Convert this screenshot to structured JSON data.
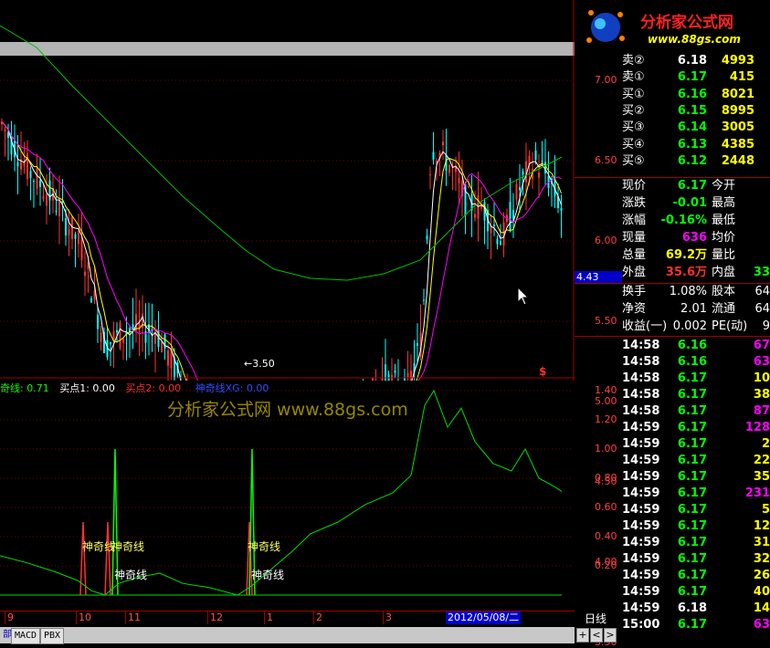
{
  "logo": {
    "title": "分析家公式网",
    "url": "www.88gs.com"
  },
  "main_chart": {
    "y_ticks": [
      "7.00",
      "6.50",
      "6.00",
      "5.50",
      "5.00",
      "4.50",
      "4.00",
      "3.50"
    ],
    "low_annotation": "←3.50",
    "current_price_tag": "4.43",
    "marker": "$"
  },
  "indicator": {
    "legend": [
      {
        "label": "奇线: 0.71",
        "color": "#00ff00"
      },
      {
        "label": "买点1: 0.00",
        "color": "#ffffff"
      },
      {
        "label": "买点2: 0.00",
        "color": "#ff3030"
      },
      {
        "label": "神奇线XG: 0.00",
        "color": "#3050ff"
      }
    ],
    "watermark": "分析家公式网 www.88gs.com",
    "y_ticks": [
      "1.40",
      "1.20",
      "1.00",
      "0.80",
      "0.60",
      "0.40",
      "0.20"
    ],
    "signal_labels": [
      "神奇线",
      "神奇线",
      "神奇线",
      "神奇线",
      "神奇线"
    ]
  },
  "x_axis": {
    "labels": [
      "9",
      "10",
      "11",
      "12",
      "1",
      "2",
      "3"
    ],
    "date_cursor": "2012/05/08/二",
    "period": "日线"
  },
  "tabs": [
    "部",
    "MACD",
    "PBX"
  ],
  "nav_buttons": [
    "+",
    "<",
    ">"
  ],
  "order_book": [
    {
      "label": "卖②",
      "price": "6.18",
      "vol": "4993"
    },
    {
      "label": "卖①",
      "price": "6.17",
      "vol": "415"
    },
    {
      "label": "买①",
      "price": "6.16",
      "vol": "8021"
    },
    {
      "label": "买②",
      "price": "6.15",
      "vol": "8995"
    },
    {
      "label": "买③",
      "price": "6.14",
      "vol": "3005"
    },
    {
      "label": "买④",
      "price": "6.13",
      "vol": "4385"
    },
    {
      "label": "买⑤",
      "price": "6.12",
      "vol": "2448"
    }
  ],
  "quote": [
    {
      "k1": "现价",
      "v1": "6.17",
      "c1": "#00ff00",
      "k2": "今开",
      "v2": ""
    },
    {
      "k1": "涨跌",
      "v1": "-0.01",
      "c1": "#00ff00",
      "k2": "最高",
      "v2": ""
    },
    {
      "k1": "涨幅",
      "v1": "-0.16%",
      "c1": "#00ff00",
      "k2": "最低",
      "v2": ""
    },
    {
      "k1": "现量",
      "v1": "636",
      "c1": "#ff00ff",
      "k2": "均价",
      "v2": ""
    },
    {
      "k1": "总量",
      "v1": "69.2万",
      "c1": "#ffff00",
      "k2": "量比",
      "v2": ""
    },
    {
      "k1": "外盘",
      "v1": "35.6万",
      "c1": "#ff3030",
      "k2": "内盘",
      "v2": "33"
    }
  ],
  "fundamentals": [
    {
      "k1": "换手",
      "v1": "1.08%",
      "k2": "股本",
      "v2": "64"
    },
    {
      "k1": "净资",
      "v1": "2.01",
      "k2": "流通",
      "v2": "64"
    },
    {
      "k1": "收益(一)",
      "v1": "0.002",
      "k2": "PE(动)",
      "v2": "9"
    }
  ],
  "ticks": [
    {
      "time": "14:58",
      "price": "6.16",
      "vol": "67",
      "vc": "#ff00ff"
    },
    {
      "time": "14:58",
      "price": "6.16",
      "vol": "63",
      "vc": "#ff00ff"
    },
    {
      "time": "14:58",
      "price": "6.17",
      "vol": "10",
      "vc": "#ffff00"
    },
    {
      "time": "14:58",
      "price": "6.17",
      "vol": "38",
      "vc": "#ffff00"
    },
    {
      "time": "14:58",
      "price": "6.17",
      "vol": "87",
      "vc": "#ff00ff"
    },
    {
      "time": "14:59",
      "price": "6.17",
      "vol": "128",
      "vc": "#ff00ff"
    },
    {
      "time": "14:59",
      "price": "6.17",
      "vol": "2",
      "vc": "#ffff00"
    },
    {
      "time": "14:59",
      "price": "6.17",
      "vol": "22",
      "vc": "#ffff00"
    },
    {
      "time": "14:59",
      "price": "6.17",
      "vol": "35",
      "vc": "#ffff00"
    },
    {
      "time": "14:59",
      "price": "6.17",
      "vol": "231",
      "vc": "#ff00ff"
    },
    {
      "time": "14:59",
      "price": "6.17",
      "vol": "5",
      "vc": "#ffff00"
    },
    {
      "time": "14:59",
      "price": "6.17",
      "vol": "12",
      "vc": "#ffff00"
    },
    {
      "time": "14:59",
      "price": "6.17",
      "vol": "31",
      "vc": "#ffff00"
    },
    {
      "time": "14:59",
      "price": "6.17",
      "vol": "32",
      "vc": "#ffff00"
    },
    {
      "time": "14:59",
      "price": "6.17",
      "vol": "26",
      "vc": "#ffff00"
    },
    {
      "time": "14:59",
      "price": "6.17",
      "vol": "40",
      "vc": "#ffff00"
    },
    {
      "time": "14:59",
      "price": "6.18",
      "vol": "14",
      "vc": "#ffff00"
    },
    {
      "time": "15:00",
      "price": "6.17",
      "vol": "63",
      "vc": "#ff00ff"
    }
  ],
  "colors": {
    "up": "#ff3030",
    "down": "#00ffff",
    "ma_white": "#ffffff",
    "ma_yellow": "#ffff00",
    "ma_magenta": "#ff00ff",
    "ma_green": "#00c000",
    "grid": "#800000"
  }
}
